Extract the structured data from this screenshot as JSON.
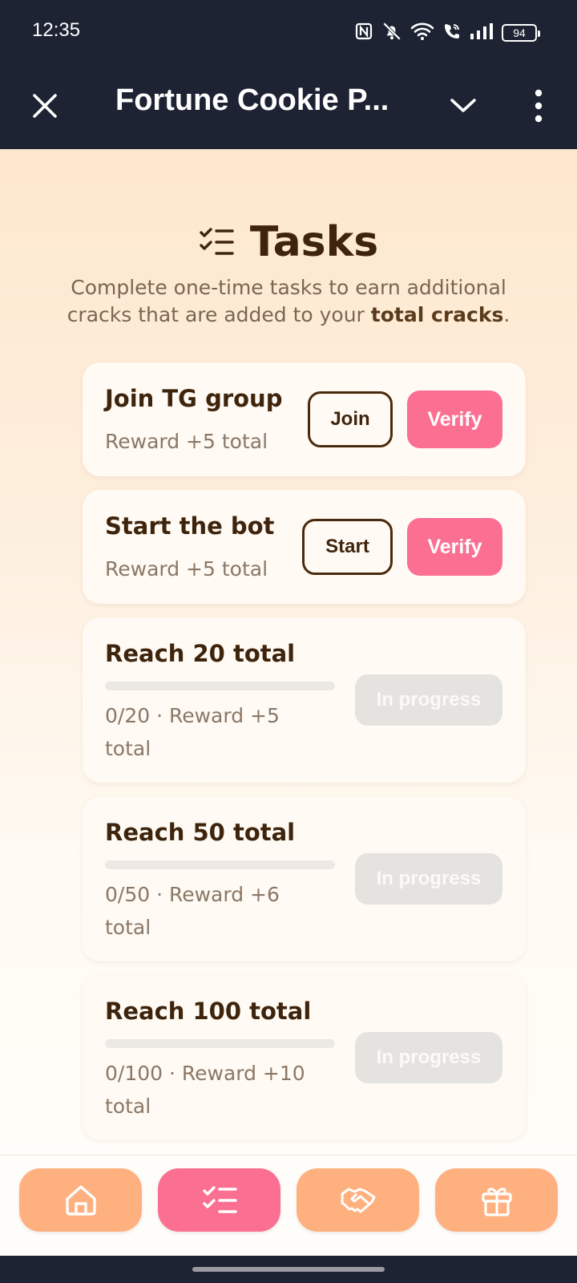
{
  "status_bar": {
    "time": "12:35",
    "battery": "94"
  },
  "app_bar": {
    "title": "Fortune Cookie P..."
  },
  "page": {
    "heading": "Tasks",
    "description_before": "Complete one-time tasks to earn additional cracks that are added to your ",
    "description_bold": "total cracks",
    "description_after": "."
  },
  "tasks": [
    {
      "title": "Join TG group",
      "subtitle": "Reward +5 total",
      "action_label": "Join",
      "verify_label": "Verify"
    },
    {
      "title": "Start the bot",
      "subtitle": "Reward +5 total",
      "action_label": "Start",
      "verify_label": "Verify"
    },
    {
      "title": "Reach 20 total",
      "subtitle": "0/20 · Reward +5 total",
      "status_label": "In progress",
      "progress": 0
    },
    {
      "title": "Reach 50 total",
      "subtitle": "0/50 · Reward +6 total",
      "status_label": "In progress",
      "progress": 0
    },
    {
      "title": "Reach 100 total",
      "subtitle": "0/100 · Reward +10 total",
      "status_label": "In progress",
      "progress": 0
    }
  ],
  "bottom_nav": [
    {
      "icon": "home-icon",
      "active": false
    },
    {
      "icon": "tasks-icon",
      "active": true
    },
    {
      "icon": "handshake-icon",
      "active": false
    },
    {
      "icon": "gift-icon",
      "active": false
    }
  ],
  "colors": {
    "accent_pink": "#fb6f92",
    "nav_orange": "#ffb07f",
    "text_brown": "#3e240c",
    "header_dark": "#1d2333"
  }
}
